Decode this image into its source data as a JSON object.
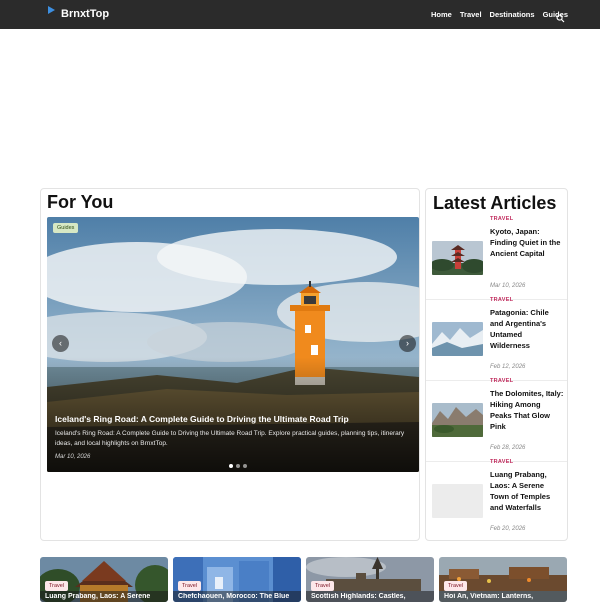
{
  "header": {
    "brand": "BrnxtTop",
    "nav": [
      "Home",
      "Travel",
      "Destinations",
      "Guides"
    ]
  },
  "for_you": {
    "title": "For You",
    "featured": {
      "badge": "Guides",
      "title": "Iceland's Ring Road: A Complete Guide to Driving the Ultimate Road Trip",
      "description": "Iceland's Ring Road: A Complete Guide to Driving the Ultimate Road Trip. Explore practical guides, planning tips, itinerary ideas, and local highlights on BrnxtTop.",
      "date": "Mar 10, 2026"
    },
    "slides_total": 3,
    "active_slide": 1
  },
  "latest": {
    "title": "Latest Articles",
    "articles": [
      {
        "category": "TRAVEL",
        "title": "Kyoto, Japan: Finding Quiet in the Ancient Capital",
        "date": "Mar 10, 2026"
      },
      {
        "category": "TRAVEL",
        "title": "Patagonia: Chile and Argentina's Untamed Wilderness",
        "date": "Feb 12, 2026"
      },
      {
        "category": "TRAVEL",
        "title": "The Dolomites, Italy: Hiking Among Peaks That Glow Pink",
        "date": "Feb 28, 2026"
      },
      {
        "category": "TRAVEL",
        "title": "Luang Prabang, Laos: A Serene Town of Temples and Waterfalls",
        "date": "Feb 20, 2026"
      }
    ]
  },
  "tiles": [
    {
      "badge": "Travel",
      "title": "Luang Prabang, Laos: A Serene"
    },
    {
      "badge": "Travel",
      "title": "Chefchaouen, Morocco: The Blue"
    },
    {
      "badge": "Travel",
      "title": "Scottish Highlands: Castles,"
    },
    {
      "badge": "Travel",
      "title": "Hoi An, Vietnam: Lanterns,"
    }
  ],
  "colors": {
    "header_bg": "#2b2b2b",
    "brand_accent": "#3d8fe0",
    "category": "#c02a5c"
  },
  "icons": [
    "play-logo-icon",
    "search-icon",
    "chevron-left-icon",
    "chevron-right-icon"
  ]
}
